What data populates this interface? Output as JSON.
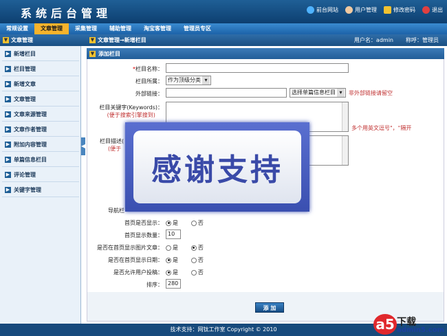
{
  "app": {
    "title": "系统后台管理"
  },
  "top_links": [
    {
      "label": "前台网站",
      "icon": "globe-icon",
      "color": "#4fb3ff"
    },
    {
      "label": "用户管理",
      "icon": "user-icon",
      "color": "#f0c9a0"
    },
    {
      "label": "修改密码",
      "icon": "lock-icon",
      "color": "#f2c230"
    },
    {
      "label": "退出",
      "icon": "power-icon",
      "color": "#e04040"
    }
  ],
  "nav_tabs": [
    "常规设置",
    "文章管理",
    "采集管理",
    "辅助管理",
    "淘宝客管理",
    "管理员专区"
  ],
  "sub_bar": {
    "sidebar_title": "文章管理",
    "breadcrumb": "文章管理→新增栏目",
    "user_label": "用户名：admin",
    "role_label": "称呼：管理员"
  },
  "sidebar_items": [
    "新增栏目",
    "栏目管理",
    "新增文章",
    "文章管理",
    "文章来源管理",
    "文章作者管理",
    "附加内容管理",
    "单篇信息栏目",
    "评论管理",
    "关键字管理"
  ],
  "panel": {
    "title": "添加栏目"
  },
  "form": {
    "name_label": "栏目名称：",
    "parent_label": "栏目所属：",
    "parent_value": "作为顶级分类",
    "link_label": "外部链接：",
    "link_select": "选择单篇信息栏目",
    "link_hint": "非外部链接请留空",
    "keywords_label": "栏目关键字(Keywords)：",
    "keywords_hint": "(便于搜索引擎搜到)",
    "keywords_note": "多个用英文逗号\"，\"隔开",
    "desc_label": "栏目描述(",
    "desc_hint": "(便于",
    "nav_label": "导航栏",
    "home_show_label": "首页是否显示：",
    "home_count_label": "首页显示数量：",
    "home_count_value": "10",
    "img_label": "是否在首页显示图片文章：",
    "date_label": "是否在首页显示日期：",
    "submit_label": "是否允许用户投稿：",
    "sort_label": "排序：",
    "sort_value": "280",
    "yes": "是",
    "no": "否"
  },
  "button": {
    "add": "添 加"
  },
  "footer": {
    "text": "技术支持：网钛工作室 Copyright © 2010"
  },
  "overlay": {
    "text": "感谢支持"
  },
  "watermark": {
    "logo": "a5",
    "brand": "下载",
    "domain": "admin5.com"
  }
}
